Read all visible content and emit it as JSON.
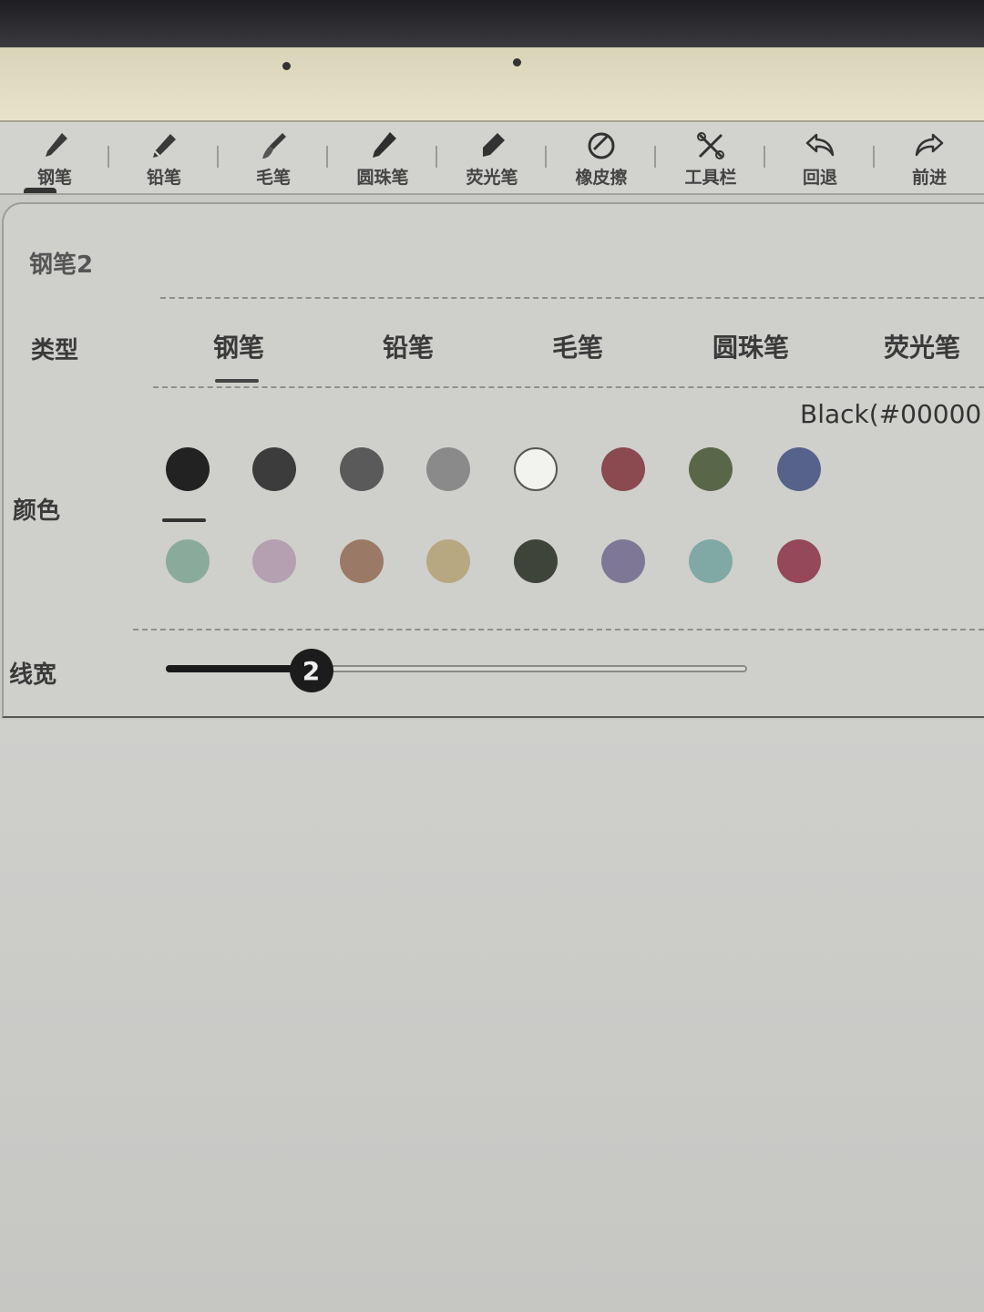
{
  "toolbar": {
    "tools": [
      {
        "label": "钢笔",
        "icon": "fountain-pen-icon"
      },
      {
        "label": "铅笔",
        "icon": "pencil-icon"
      },
      {
        "label": "毛笔",
        "icon": "brush-icon"
      },
      {
        "label": "圆珠笔",
        "icon": "ballpoint-pen-icon"
      },
      {
        "label": "荧光笔",
        "icon": "highlighter-icon"
      },
      {
        "label": "橡皮擦",
        "icon": "eraser-icon"
      },
      {
        "label": "工具栏",
        "icon": "tools-icon"
      },
      {
        "label": "回退",
        "icon": "undo-icon"
      },
      {
        "label": "前进",
        "icon": "redo-icon"
      }
    ],
    "active_index": 0
  },
  "panel": {
    "preset_title": "钢笔2",
    "type": {
      "label": "类型",
      "options": [
        "钢笔",
        "铅笔",
        "毛笔",
        "圆珠笔",
        "荧光笔"
      ],
      "selected_index": 0
    },
    "color": {
      "label": "颜色",
      "readout": "Black(#00000",
      "row1": [
        "#222222",
        "#3c3c3c",
        "#5a5a5a",
        "#8a8a8a",
        "#f2f2ee",
        "#8a4a50",
        "#5a6648",
        "#56628a"
      ],
      "row2": [
        "#8aaa9c",
        "#b4a0b0",
        "#9a7a66",
        "#b8a882",
        "#3e443a",
        "#7e7896",
        "#80a8a4",
        "#94485a"
      ],
      "selected": "row1-0"
    },
    "width": {
      "label": "线宽",
      "value": "2",
      "fraction": 0.25
    }
  }
}
